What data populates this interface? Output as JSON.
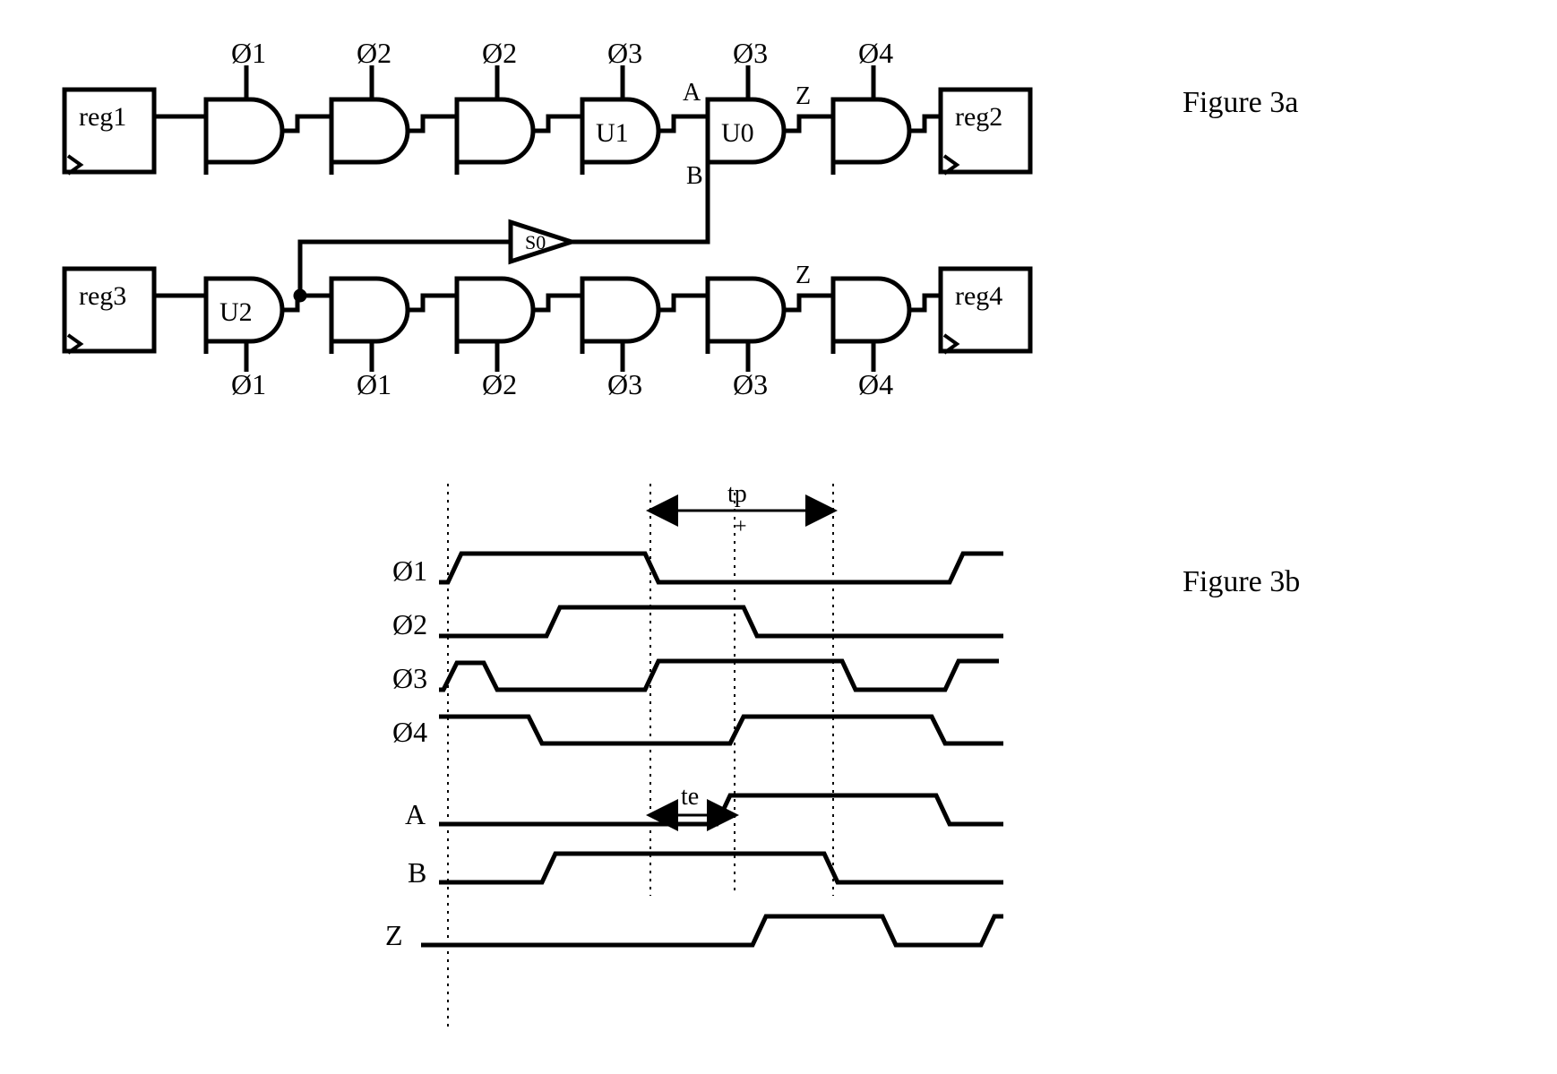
{
  "figure_a": {
    "caption": "Figure 3a",
    "registers": {
      "r1": "reg1",
      "r2": "reg2",
      "r3": "reg3",
      "r4": "reg4"
    },
    "gates_top_phase": [
      "Ø1",
      "Ø2",
      "Ø2",
      "Ø3",
      "Ø3",
      "Ø4"
    ],
    "gates_bot_phase": [
      "Ø1",
      "Ø1",
      "Ø2",
      "Ø3",
      "Ø3",
      "Ø4"
    ],
    "gate_labels": {
      "u0": "U0",
      "u1": "U1",
      "u2": "U2",
      "s0": "S0"
    },
    "net_labels": {
      "a": "A",
      "b": "B",
      "z": "Z"
    }
  },
  "figure_b": {
    "caption": "Figure 3b",
    "signals": [
      "Ø1",
      "Ø2",
      "Ø3",
      "Ø4",
      "A",
      "B",
      "Z"
    ],
    "annot": {
      "tp": "tp",
      "plus": "+",
      "te": "te"
    }
  }
}
